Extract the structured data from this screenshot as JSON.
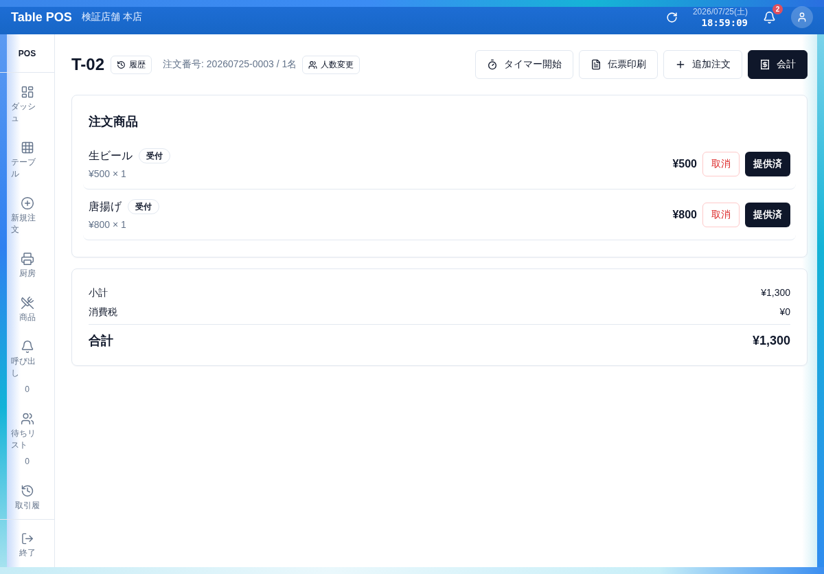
{
  "header": {
    "app_name": "Table POS",
    "store_name": "検証店舗 本店",
    "date": "2026/07/25(土)",
    "time": "18:59:09",
    "notification_count": "2"
  },
  "sidebar": {
    "title": "POS",
    "items": [
      {
        "label": "ダッシュ",
        "selected": false
      },
      {
        "label": "テーブル",
        "selected": false
      },
      {
        "label": "新規注文",
        "selected": false
      },
      {
        "label": "厨房",
        "selected": false
      },
      {
        "label": "商品",
        "selected": false
      },
      {
        "label": "呼び出し",
        "count": "0",
        "selected": false
      },
      {
        "label": "待ちリスト",
        "count": "0",
        "selected": false
      },
      {
        "label": "取引履",
        "selected": false
      }
    ],
    "footer_item": {
      "label": "終了"
    }
  },
  "order": {
    "table": "T-02",
    "history_button": "履歴",
    "order_info": "注文番号: 20260725-0003 / 1名",
    "guests_button": "人数変更",
    "actions": [
      {
        "label": "タイマー開始",
        "kind": "outline"
      },
      {
        "label": "伝票印刷",
        "kind": "outline"
      },
      {
        "label": "追加注文",
        "kind": "outline"
      },
      {
        "label": "会計",
        "kind": "primary"
      }
    ]
  },
  "items_card": {
    "title": "注文商品",
    "items": [
      {
        "name": "生ビール",
        "status": "受付",
        "unit": "¥500 × 1",
        "price": "¥500",
        "cancel_button": "取消",
        "serve_button": "提供済"
      },
      {
        "name": "唐揚げ",
        "status": "受付",
        "unit": "¥800 × 1",
        "price": "¥800",
        "cancel_button": "取消",
        "serve_button": "提供済"
      }
    ]
  },
  "totals": {
    "rows": [
      {
        "label": "小計",
        "value": "¥1,300"
      },
      {
        "label": "消費税",
        "value": "¥0"
      }
    ],
    "total": {
      "label": "合計",
      "value": "¥1,300"
    }
  }
}
